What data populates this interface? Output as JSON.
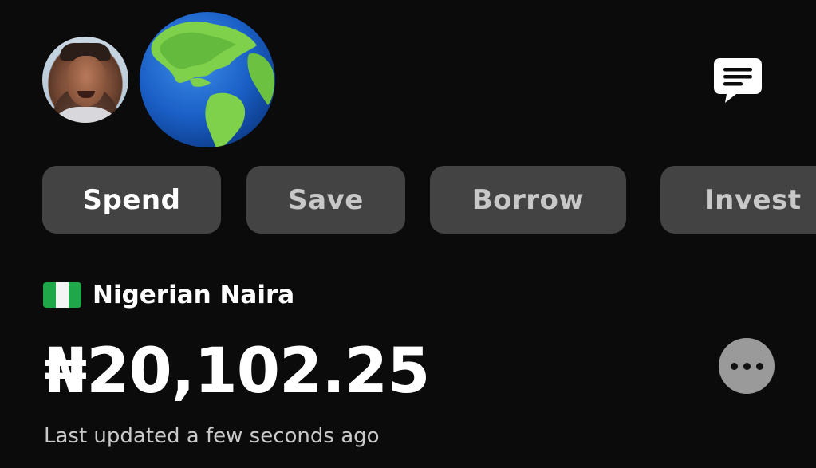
{
  "header": {
    "avatar": "user-avatar",
    "globe": "globe-icon",
    "chat": "chat-icon"
  },
  "tabs": [
    {
      "label": "Spend",
      "active": true
    },
    {
      "label": "Save",
      "active": false
    },
    {
      "label": "Borrow",
      "active": false
    },
    {
      "label": "Invest",
      "active": false
    }
  ],
  "account": {
    "flag": "nigeria-flag-icon",
    "currency_name": "Nigerian Naira",
    "balance": "₦20,102.25",
    "last_updated": "Last updated a few seconds ago",
    "more_icon": "more-horizontal-icon"
  },
  "colors": {
    "background": "#0b0b0c",
    "tab_background": "#434343",
    "more_button": "#9a9a9a",
    "flag_green": "#1fa84a"
  }
}
